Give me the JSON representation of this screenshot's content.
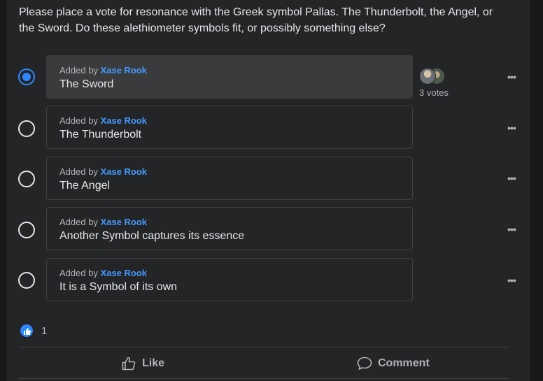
{
  "poll": {
    "question": "Please place a vote for resonance with the Greek symbol Pallas. The Thunderbolt, the Angel, or the Sword. Do these alethiometer symbols fit, or possibly something else?",
    "options": [
      {
        "added_prefix": "Added by",
        "author": "Xase Rook",
        "label": "The Sword",
        "selected": true
      },
      {
        "added_prefix": "Added by",
        "author": "Xase Rook",
        "label": "The Thunderbolt",
        "selected": false
      },
      {
        "added_prefix": "Added by",
        "author": "Xase Rook",
        "label": "The Angel",
        "selected": false
      },
      {
        "added_prefix": "Added by",
        "author": "Xase Rook",
        "label": "Another Symbol captures its essence",
        "selected": false
      },
      {
        "added_prefix": "Added by",
        "author": "Xase Rook",
        "label": "It is a Symbol of its own",
        "selected": false
      }
    ],
    "votes_label": "3 votes",
    "more_glyph": "•••"
  },
  "reactions": {
    "count": "1",
    "icon": "like-icon"
  },
  "actions": {
    "like_label": "Like",
    "comment_label": "Comment"
  },
  "colors": {
    "background": "#242526",
    "accent": "#2d88ff",
    "author_link": "#4599ff",
    "text": "#e4e6eb",
    "secondary_text": "#b0b3b8"
  }
}
